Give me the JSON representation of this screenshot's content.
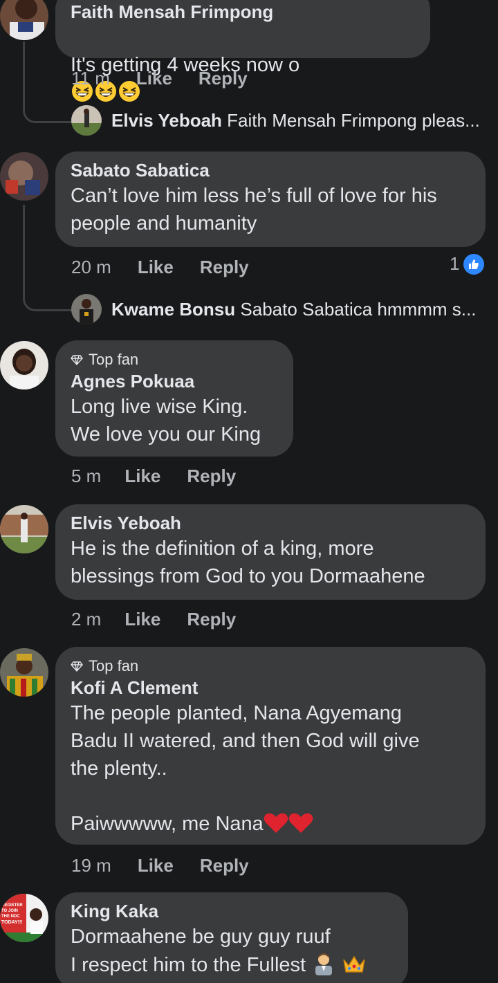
{
  "comments": [
    {
      "name": "Faith Mensah Frimpong",
      "text": "It's getting 4 weeks now o",
      "emojis": [
        "grinning-squinting-face",
        "grinning-squinting-face",
        "grinning-squinting-face"
      ],
      "time": "11 m",
      "like": "Like",
      "reply": "Reply",
      "reply_preview": {
        "name": "Elvis Yeboah",
        "text": "Faith Mensah Frimpong pleas..."
      }
    },
    {
      "name": "Sabato Sabatica",
      "text": "Can’t love him less he’s full of love for his\npeople and humanity",
      "time": "20 m",
      "like": "Like",
      "reply": "Reply",
      "reaction_count": "1",
      "reply_preview": {
        "name": "Kwame Bonsu",
        "text": "Sabato Sabatica hmmmm s..."
      }
    },
    {
      "badge": "Top fan",
      "name": "Agnes Pokuaa",
      "text": "Long live wise King.\nWe love you our King",
      "time": "5 m",
      "like": "Like",
      "reply": "Reply"
    },
    {
      "name": "Elvis Yeboah",
      "text": "He is the definition of a king, more\nblessings from God to you Dormaahene",
      "time": "2 m",
      "like": "Like",
      "reply": "Reply"
    },
    {
      "badge": "Top fan",
      "name": "Kofi A Clement",
      "text": "The people planted, Nana Agyemang\nBadu II watered, and then God will give\nthe plenty..\n\nPaiwwwww, me Nana",
      "emojis": [
        "red-heart",
        "red-heart"
      ],
      "time": "19 m",
      "like": "Like",
      "reply": "Reply"
    },
    {
      "name": "King Kaka",
      "text": "Dormaahene be guy guy ruuf\nI respect him to the Fullest",
      "emojis": [
        "man-office-worker",
        "crown"
      ],
      "avatar_text": [
        "REGISTER",
        "TO JOIN",
        "THE NDC",
        "TODAY!!!"
      ]
    }
  ],
  "colors": {
    "background": "#18191a",
    "bubble": "#3a3b3c",
    "text": "#e4e6eb",
    "muted": "#b0b3b8",
    "like_blue": "#2d88ff"
  }
}
